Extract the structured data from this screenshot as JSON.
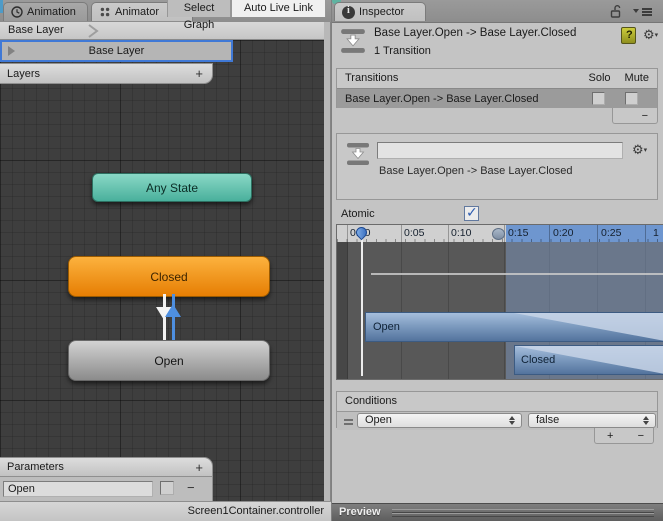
{
  "animator_pane": {
    "tab_animation": "Animation",
    "tab_animator": "Animator",
    "breadcrumb": "Base Layer",
    "select_graph": "Select Graph",
    "auto_live_link": "Auto Live Link",
    "layer_row": "Base Layer",
    "layers_title": "Layers",
    "layers_add": "+",
    "node_any_state": "Any State",
    "node_closed": "Closed",
    "node_open": "Open",
    "parameters_title": "Parameters",
    "parameters_add": "+",
    "parameter_name": "Open",
    "parameter_remove": "−",
    "status": "Screen1Container.controller"
  },
  "inspector_pane": {
    "tab": "Inspector",
    "title": "Base Layer.Open -> Base Layer.Closed",
    "subtitle": "1 Transition",
    "transitions_title": "Transitions",
    "solo": "Solo",
    "mute": "Mute",
    "transition_row": "Base Layer.Open -> Base Layer.Closed",
    "transitions_remove": "−",
    "detail_name": "",
    "detail_label": "Base Layer.Open -> Base Layer.Closed",
    "atomic_label": "Atomic",
    "atomic_checked": true,
    "timeline_ticks": [
      "0:00",
      "0:05",
      "0:10",
      "0:15",
      "0:20",
      "0:25",
      "1"
    ],
    "clip_open": "Open",
    "clip_closed": "Closed",
    "conditions_title": "Conditions",
    "condition_parameter": "Open",
    "condition_value": "false",
    "conditions_add": "+",
    "conditions_remove": "−",
    "preview": "Preview"
  },
  "colors": {
    "selection_blue": "#4079d6",
    "timeline_selection": "#6e96cf",
    "node_teal": "#5bc0ab",
    "node_orange": "#f09609",
    "node_gray": "#aeaeae"
  }
}
